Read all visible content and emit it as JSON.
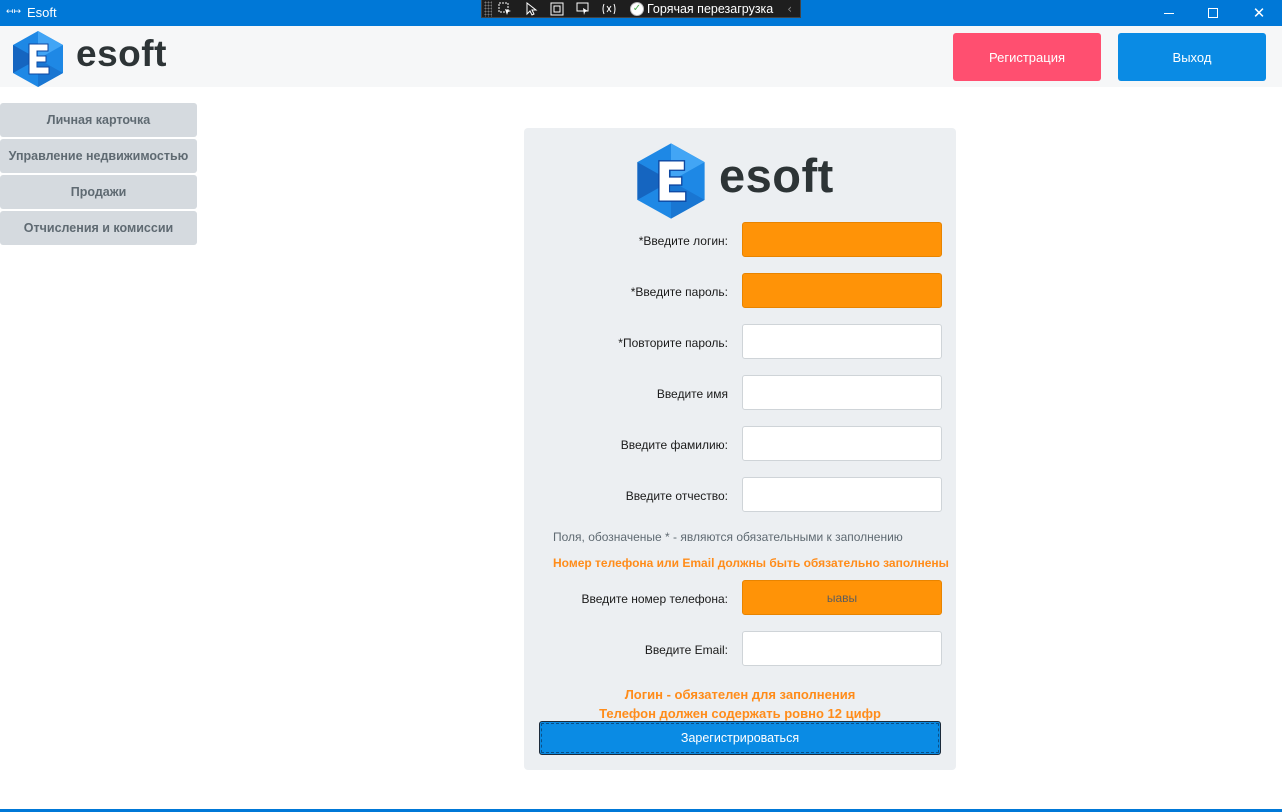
{
  "window": {
    "title": "Esoft",
    "app_icon": "↤↦"
  },
  "debug_toolbar": {
    "hot_reload_label": "Горячая перезагрузка",
    "ok_glyph": "✓",
    "chevron": "‹"
  },
  "header": {
    "brand": "esoft",
    "register_label": "Регистрация",
    "exit_label": "Выход"
  },
  "sidebar": {
    "items": [
      {
        "label": "Личная карточка"
      },
      {
        "label": "Управление недвижимостью"
      },
      {
        "label": "Продажи"
      },
      {
        "label": "Отчисления и комиссии"
      }
    ]
  },
  "form": {
    "brand": "esoft",
    "fields": {
      "login": {
        "label": "*Введите логин:",
        "value": "",
        "error": true
      },
      "password": {
        "label": "*Введите пароль:",
        "value": "",
        "error": true
      },
      "password_repeat": {
        "label": "*Повторите пароль:",
        "value": "",
        "error": false
      },
      "first_name": {
        "label": "Введите имя",
        "value": "",
        "error": false
      },
      "last_name": {
        "label": "Введите фамилию:",
        "value": "",
        "error": false
      },
      "middle_name": {
        "label": "Введите отчество:",
        "value": "",
        "error": false
      },
      "phone": {
        "label": "Введите номер телефона:",
        "value": "ыавы",
        "error": true
      },
      "email": {
        "label": "Введите Email:",
        "value": "",
        "error": false
      }
    },
    "required_note": "Поля, обозначеные * - являются обязательными к заполнению",
    "contact_warning": "Номер телефона или Email должны быть обязательно заполнены",
    "errors": [
      "Логин - обязателен для заполнения",
      "Телефон должен содержать ровно 12 цифр"
    ],
    "submit_label": "Зарегистрироваться"
  },
  "colors": {
    "titlebar": "#0078d7",
    "accent_blue": "#0a8be4",
    "register_pink": "#ff4f70",
    "error_orange": "#ff9307",
    "warning_text": "#ff8c1a"
  }
}
